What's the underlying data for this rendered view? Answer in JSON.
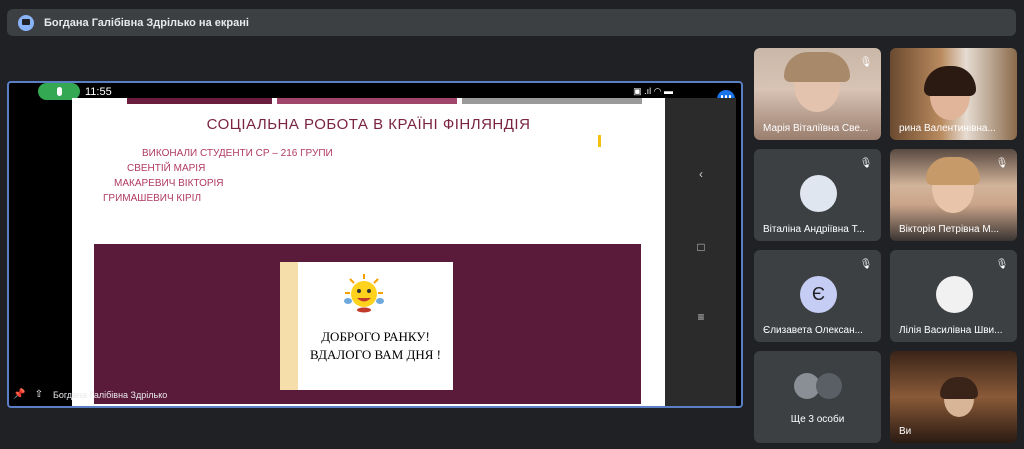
{
  "top_bar": {
    "presenter_text": "Богдана Галібівна Здрілько на екрані"
  },
  "stage": {
    "phone_time": "11:55",
    "phone_status_right": "▣ .ıl ◠ ▬",
    "presenter_label": "Богдана Галібівна Здрілько",
    "slide": {
      "heading": "СОЦІАЛЬНА РОБОТА В КРАЇНІ ФІНЛЯНДІЯ",
      "authors_line1": "ВИКОНАЛИ СТУДЕНТИ  СР – 216 ГРУПИ",
      "author1": "СВЕНТІЙ МАРІЯ",
      "author2": "МАКАРЕВИЧ ВІКТОРІЯ",
      "author3": "ГРИМАШЕВИЧ КІРІЛ",
      "greeting_line1": "ДОБРОГО РАНКУ!",
      "greeting_line2": "ВДАЛОГО ВАМ ДНЯ !"
    }
  },
  "participants": [
    {
      "name": "Марія Віталіївна Све..."
    },
    {
      "name": "рина Валентинівна..."
    },
    {
      "name": "Віталіна Андріївна Т...",
      "avatar_letter": ""
    },
    {
      "name": "Вікторія Петрівна М..."
    },
    {
      "name": "Єлизавета Олексан...",
      "avatar_letter": "Є"
    },
    {
      "name": "Лілія Василівна Шви..."
    },
    {
      "name": "Ще 3 особи"
    },
    {
      "name": "Ви"
    }
  ],
  "colors": {
    "background": "#202124",
    "tile": "#3c4043",
    "accent_blue": "#1a73e8",
    "mic_green": "#34a853",
    "slide_maroon": "#5a1a3a"
  }
}
